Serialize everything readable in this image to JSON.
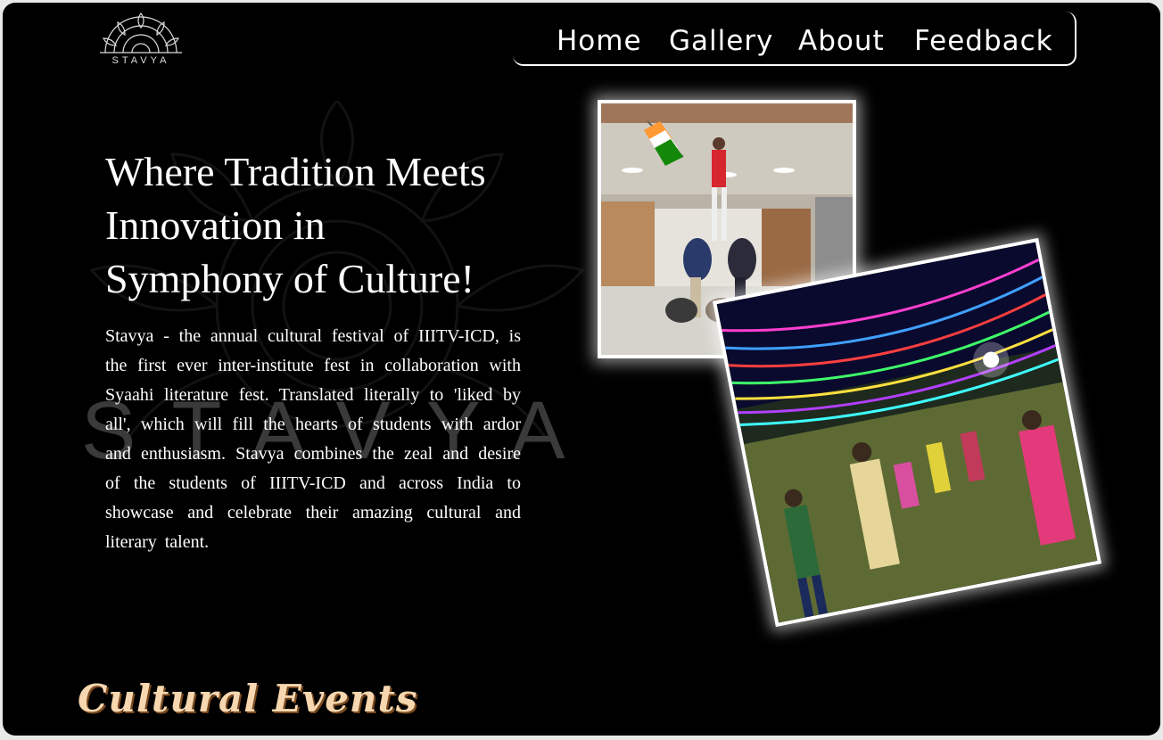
{
  "brand": {
    "logo_text": "STAVYA",
    "watermark_text": "STAVYA"
  },
  "nav": {
    "items": [
      {
        "label": "Home"
      },
      {
        "label": "Gallery"
      },
      {
        "label": "About"
      },
      {
        "label": "Feedback"
      }
    ]
  },
  "hero": {
    "headline_line1": "Where Tradition Meets",
    "headline_line2": "Innovation in",
    "headline_line3": "Symphony of Culture!",
    "description": "Stavya - the annual cultural festival of IIITV-ICD, is the first ever inter-institute fest in collaboration with Syaahi literature fest. Translated literally to 'liked by all', which will fill the hearts of students with ardor and enthusiasm. Stavya combines the zeal and desire of the students of IIITV-ICD and across India to showcase and celebrate their amazing cultural and literary talent."
  },
  "photos": [
    {
      "subject": "human-pyramid-flag-photo"
    },
    {
      "subject": "garba-dance-lights-photo"
    }
  ],
  "sections": {
    "cultural_events_title": "Cultural Events"
  },
  "colors": {
    "background": "#000000",
    "text": "#ffffff",
    "section_title": "#f7d7b0"
  }
}
